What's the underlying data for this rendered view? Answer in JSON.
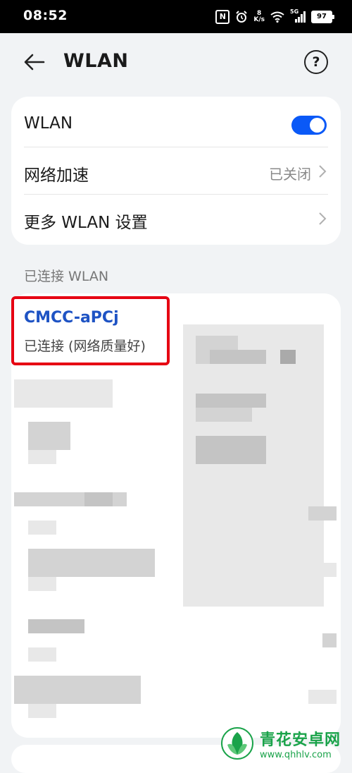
{
  "status_bar": {
    "time": "08:52",
    "speed_value": "8",
    "speed_unit": "K/s",
    "signal_label": "5G",
    "battery": "97"
  },
  "header": {
    "title": "WLAN",
    "help_label": "?"
  },
  "settings": {
    "wlan_label": "WLAN",
    "wlan_enabled": true,
    "accel_label": "网络加速",
    "accel_value": "已关闭",
    "more_label": "更多 WLAN 设置"
  },
  "connected_section": {
    "title": "已连接 WLAN",
    "network_name": "CMCC-aPCj",
    "network_status": "已连接 (网络质量好)"
  },
  "watermark": {
    "name": "青花安卓网",
    "url": "www.qhhlv.com"
  },
  "colors": {
    "accent": "#0a59f7",
    "link": "#1e53c4",
    "highlight_border": "#e60012",
    "background": "#f1f3f5",
    "watermark": "#1aa34a"
  }
}
